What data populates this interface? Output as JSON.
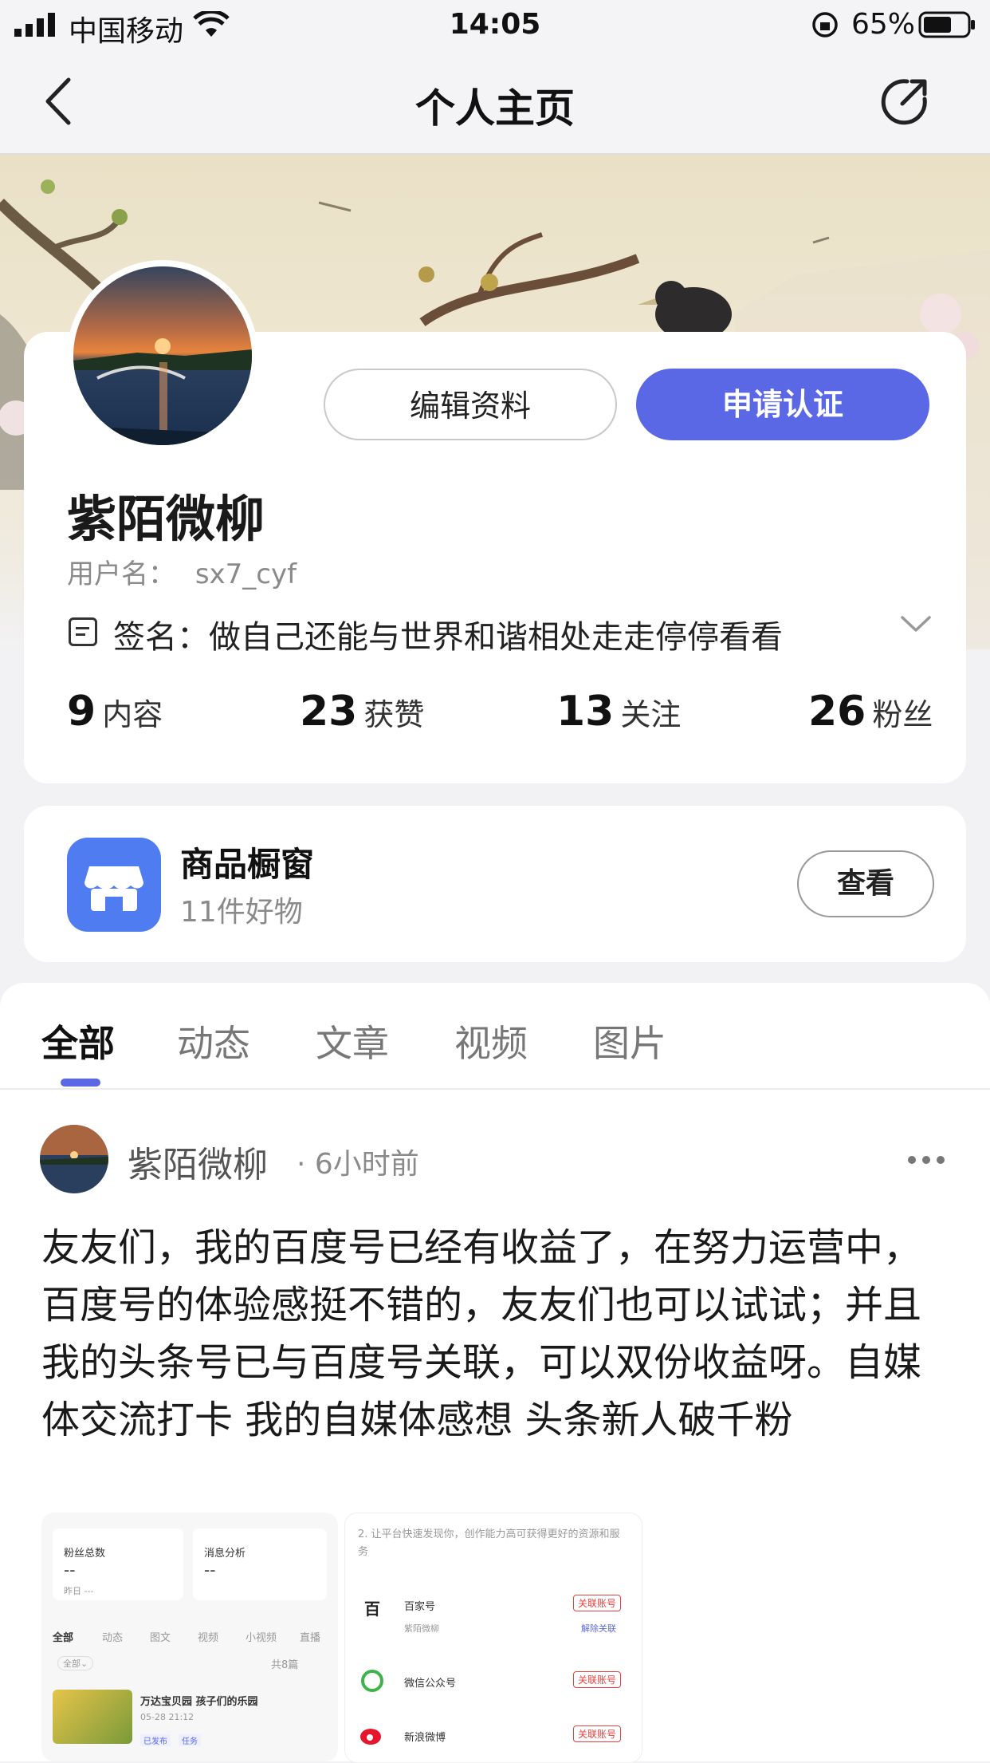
{
  "status_bar": {
    "carrier": "中国移动",
    "time": "14:05",
    "battery": "65%"
  },
  "nav": {
    "title": "个人主页"
  },
  "profile": {
    "name": "紫陌微柳",
    "username_label": "用户名：",
    "username": "sx7_cyf",
    "signature_label": "签名：",
    "signature": "做自己还能与世界和谐相处走走停停看看",
    "edit_button": "编辑资料",
    "verify_button": "申请认证",
    "stats": [
      {
        "value": "9",
        "label": "内容"
      },
      {
        "value": "23",
        "label": "获赞"
      },
      {
        "value": "13",
        "label": "关注"
      },
      {
        "value": "26",
        "label": "粉丝"
      }
    ]
  },
  "shop": {
    "title": "商品橱窗",
    "subtitle": "11件好物",
    "view_button": "查看"
  },
  "tabs": [
    {
      "label": "全部",
      "active": true
    },
    {
      "label": "动态",
      "active": false
    },
    {
      "label": "文章",
      "active": false
    },
    {
      "label": "视频",
      "active": false
    },
    {
      "label": "图片",
      "active": false
    }
  ],
  "post": {
    "author": "紫陌微柳",
    "time": "· 6小时前",
    "text": "友友们，我的百度号已经有收益了，在努力运营中，百度号的体验感挺不错的，友友们也可以试试；并且我的头条号已与百度号关联，可以双份收益呀。自媒体交流打卡 我的自媒体感想 头条新人破千粉",
    "thumb1": {
      "fans_total": "粉丝总数",
      "fans_value": "--",
      "yesterday": "昨日 ---",
      "msg_analysis": "消息分析",
      "msg_value": "--",
      "tabs": [
        "全部",
        "动态",
        "图文",
        "视频",
        "小视频",
        "直播"
      ],
      "filter": "全部⌄",
      "count": "共8篇",
      "article_title": "万达宝贝园  孩子们的乐园",
      "article_date": "05-28 21:12",
      "tag1": "已发布",
      "tag2": "任务"
    },
    "thumb2": {
      "intro": "2. 让平台快速发现你，创作能力高可获得更好的资源和服务",
      "rows": [
        {
          "name": "百家号",
          "action": "关联账号",
          "sub": "紫陌微柳",
          "sub_action": "解除关联"
        },
        {
          "name": "微信公众号",
          "action": "关联账号"
        },
        {
          "name": "新浪微博",
          "action": "关联账号"
        }
      ]
    }
  },
  "colors": {
    "accent": "#5a68e6",
    "shop_icon": "#4f7cf0",
    "link_red": "#e54141"
  }
}
